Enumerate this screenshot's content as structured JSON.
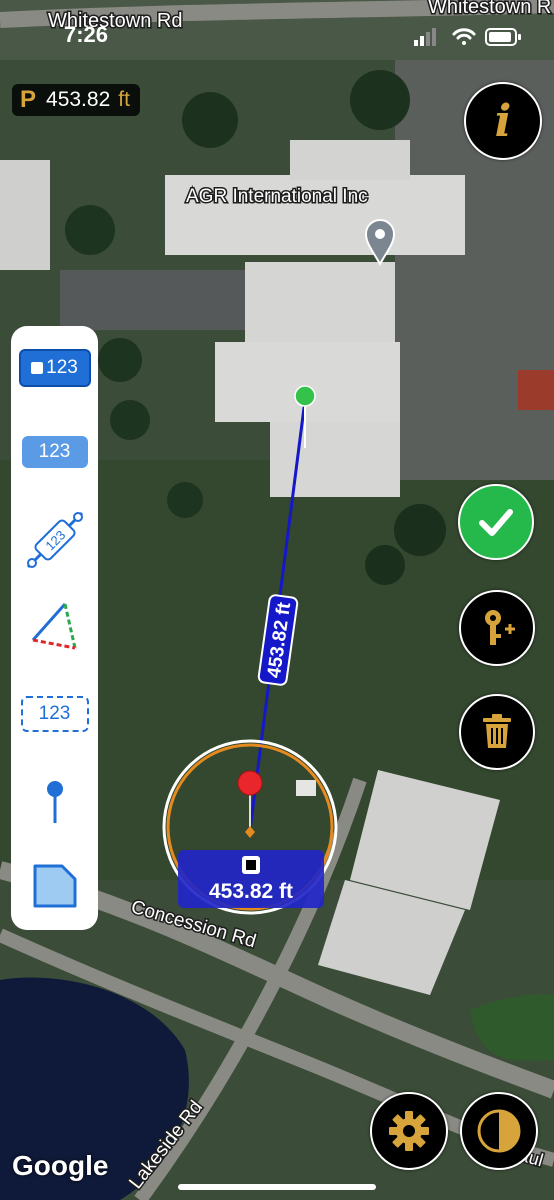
{
  "status_bar": {
    "time": "7:26"
  },
  "perimeter": {
    "prefix": "P",
    "value": "453.82",
    "unit": "ft"
  },
  "map": {
    "streets": [
      "Whitestown Rd",
      "Whitestown R",
      "Concession Rd",
      "Lakeside Rd",
      "aul"
    ],
    "place_label": "AGR International Inc",
    "watermark": "Google"
  },
  "measurement": {
    "line_label": "453.82  ft",
    "magnifier_readout": "453.82  ft"
  },
  "toolbar": {
    "items": [
      {
        "name": "distance-tool",
        "label": "123",
        "selected": true
      },
      {
        "name": "text-label-tool",
        "label": "123"
      },
      {
        "name": "segment-tool",
        "label": "123"
      },
      {
        "name": "triangle-tool"
      },
      {
        "name": "area-tool",
        "label": "123"
      },
      {
        "name": "pin-tool"
      },
      {
        "name": "shape-tool"
      }
    ]
  },
  "colors": {
    "accent_gold": "#d6a43b",
    "measure_line": "#1418c8",
    "confirm_green": "#25b84a",
    "tool_blue": "#1f6fd6"
  },
  "icons": [
    "info-icon",
    "checkmark-icon",
    "add-key-icon",
    "trash-icon",
    "gear-icon",
    "contrast-icon",
    "signal-icon",
    "wifi-icon",
    "battery-icon"
  ]
}
